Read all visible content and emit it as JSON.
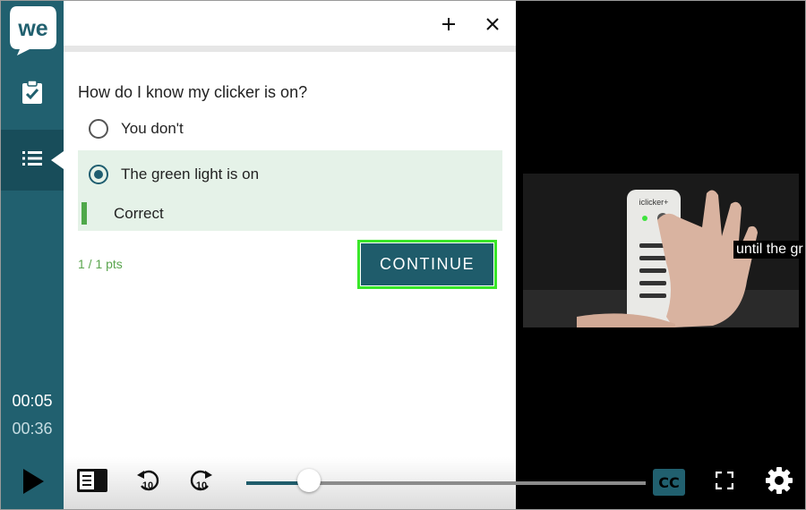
{
  "sidebar": {
    "logo_text": "we",
    "time_current": "00:05",
    "time_total": "00:36",
    "accent_color": "#21606f"
  },
  "panel": {
    "question": "How do I know my clicker is on?",
    "options": [
      {
        "label": "You don't",
        "selected": false
      },
      {
        "label": "The green light is on",
        "selected": true
      }
    ],
    "feedback": "Correct",
    "points": "1 / 1 pts",
    "continue_label": "CONTINUE",
    "icons": [
      "plus-icon",
      "close-icon"
    ]
  },
  "video": {
    "caption": "until the gr",
    "device_label": "iclicker+"
  },
  "controls": {
    "progress_fraction": 0.156,
    "cc_label": "CC",
    "back_label": "10",
    "forward_label": "10"
  }
}
